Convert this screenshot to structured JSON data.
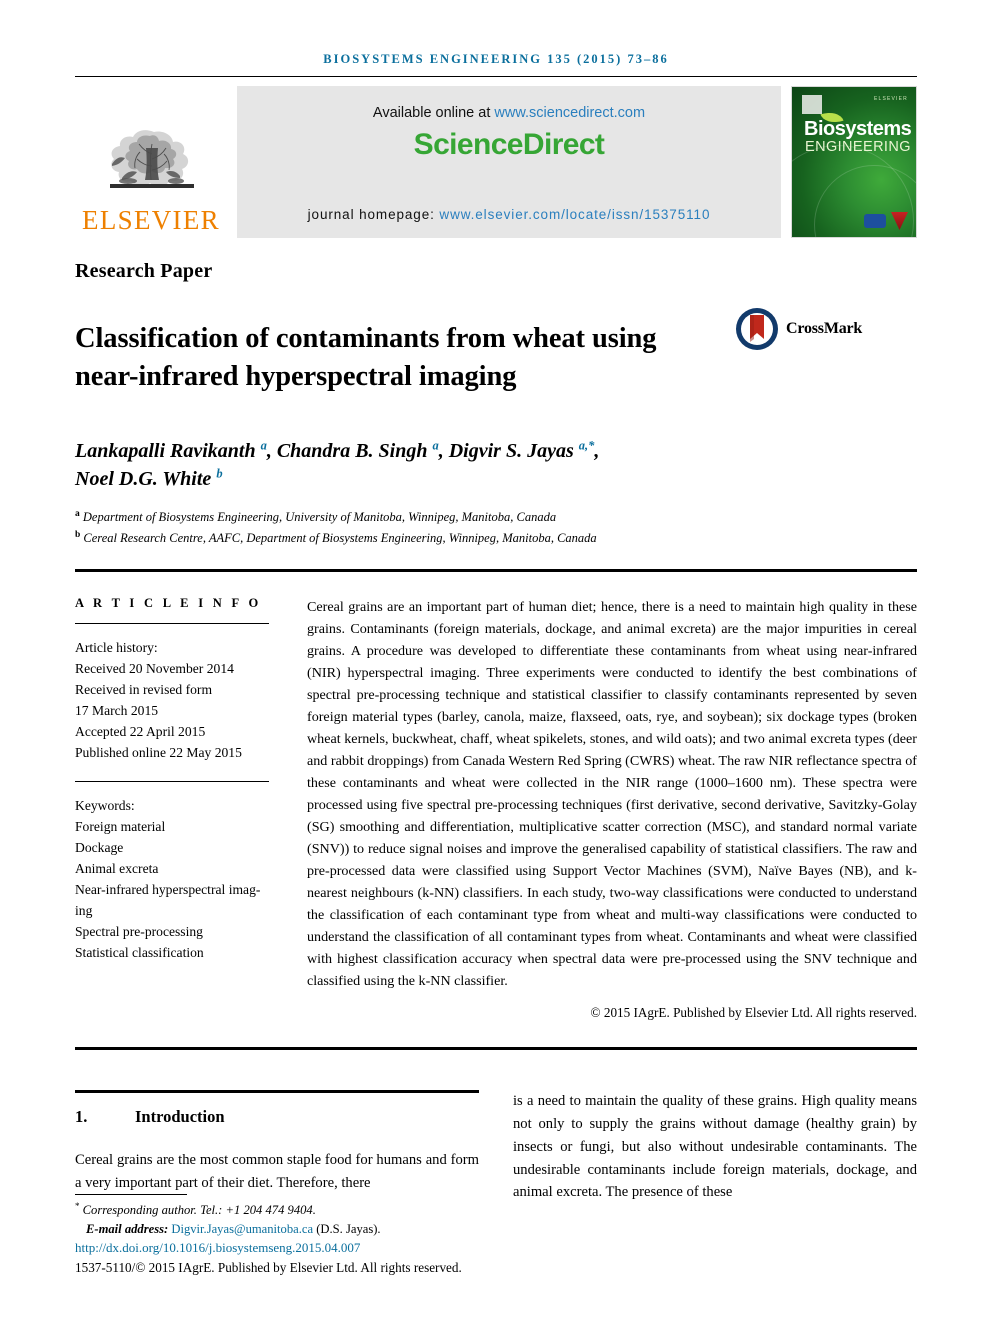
{
  "running_head": "BIOSYSTEMS ENGINEERING 135 (2015) 73–86",
  "masthead": {
    "publisher_name": "ELSEVIER",
    "publisher_logo_alt": "elsevier-tree-logo",
    "available_prefix": "Available online at ",
    "available_url": "www.sciencedirect.com",
    "sciencedirect_part1": "Science",
    "sciencedirect_part2": "Direct",
    "homepage_label": "journal homepage: ",
    "homepage_url": "www.elsevier.com/locate/issn/15375110",
    "cover": {
      "title_line1": "Biosystems",
      "title_line2": "ENGINEERING",
      "corner_text": "ELSEVIER"
    }
  },
  "article": {
    "type": "Research Paper",
    "title_line1": "Classification of contaminants from wheat using",
    "title_line2": "near-infrared hyperspectral imaging",
    "crossmark_label": "CrossMark",
    "authors": [
      {
        "name": "Lankapalli Ravikanth ",
        "mark": "a",
        "sep": ", "
      },
      {
        "name": "Chandra B. Singh ",
        "mark": "a",
        "sep": ", "
      },
      {
        "name": "Digvir S. Jayas ",
        "mark": "a,*",
        "sep": ","
      },
      {
        "name": "Noel D.G. White ",
        "mark": "b",
        "sep": ""
      }
    ],
    "affiliations": [
      {
        "mark": "a",
        "text": "Department of Biosystems Engineering, University of Manitoba, Winnipeg, Manitoba, Canada"
      },
      {
        "mark": "b",
        "text": "Cereal Research Centre, AAFC, Department of Biosystems Engineering, Winnipeg, Manitoba, Canada"
      }
    ]
  },
  "article_info": {
    "heading": "A R T I C L E  I N F O",
    "history_label": "Article history:",
    "history": [
      "Received 20 November 2014",
      "Received in revised form",
      "17 March 2015",
      "Accepted 22 April 2015",
      "Published online 22 May 2015"
    ],
    "keywords_label": "Keywords:",
    "keywords": [
      "Foreign material",
      "Dockage",
      "Animal excreta",
      "Near-infrared hyperspectral imag-",
      "ing",
      "Spectral pre-processing",
      "Statistical classification"
    ]
  },
  "abstract": {
    "text": "Cereal grains are an important part of human diet; hence, there is a need to maintain high quality in these grains. Contaminants (foreign materials, dockage, and animal excreta) are the major impurities in cereal grains. A procedure was developed to differentiate these contaminants from wheat using near-infrared (NIR) hyperspectral imaging. Three experiments were conducted to identify the best combinations of spectral pre-processing technique and statistical classifier to classify contaminants represented by seven foreign material types (barley, canola, maize, flaxseed, oats, rye, and soybean); six dockage types (broken wheat kernels, buckwheat, chaff, wheat spikelets, stones, and wild oats); and two animal excreta types (deer and rabbit droppings) from Canada Western Red Spring (CWRS) wheat. The raw NIR reflectance spectra of these contaminants and wheat were collected in the NIR range (1000–1600 nm). These spectra were processed using five spectral pre-processing techniques (first derivative, second derivative, Savitzky-Golay (SG) smoothing and differentiation, multiplicative scatter correction (MSC), and standard normal variate (SNV)) to reduce signal noises and improve the generalised capability of statistical classifiers. The raw and pre-processed data were classified using Support Vector Machines (SVM), Naïve Bayes (NB), and k-nearest neighbours (k-NN) classifiers. In each study, two-way classifications were conducted to understand the classification of each contaminant type from wheat and multi-way classifications were conducted to understand the classification of all contaminant types from wheat. Contaminants and wheat were classified with highest classification accuracy when spectral data were pre-processed using the SNV technique and classified using the k-NN classifier.",
    "copyright": "© 2015 IAgrE. Published by Elsevier Ltd. All rights reserved."
  },
  "body": {
    "section_number": "1.",
    "section_title": "Introduction",
    "left_text": "Cereal grains are the most common staple food for humans and form a very important part of their diet. Therefore, there",
    "right_text": "is a need to maintain the quality of these grains. High quality means not only to supply the grains without damage (healthy grain) by insects or fungi, but also without undesirable contaminants. The undesirable contaminants include foreign materials, dockage, and animal excreta. The presence of these"
  },
  "footer": {
    "corresponding_star": "*",
    "corresponding": "Corresponding author. Tel.: +1 204 474 9404.",
    "email_label": "E-mail address: ",
    "email": "Digvir.Jayas@umanitoba.ca",
    "email_suffix": " (D.S. Jayas).",
    "doi": "http://dx.doi.org/10.1016/j.biosystemseng.2015.04.007",
    "issn_line": "1537-5110/© 2015 IAgrE. Published by Elsevier Ltd. All rights reserved."
  },
  "colors": {
    "link_blue": "#0b6f9d",
    "sciencedirect_green": "#36a635",
    "elsevier_orange": "#ee8000",
    "crossmark_red": "#c0281c",
    "crossmark_blue": "#123a6b"
  }
}
